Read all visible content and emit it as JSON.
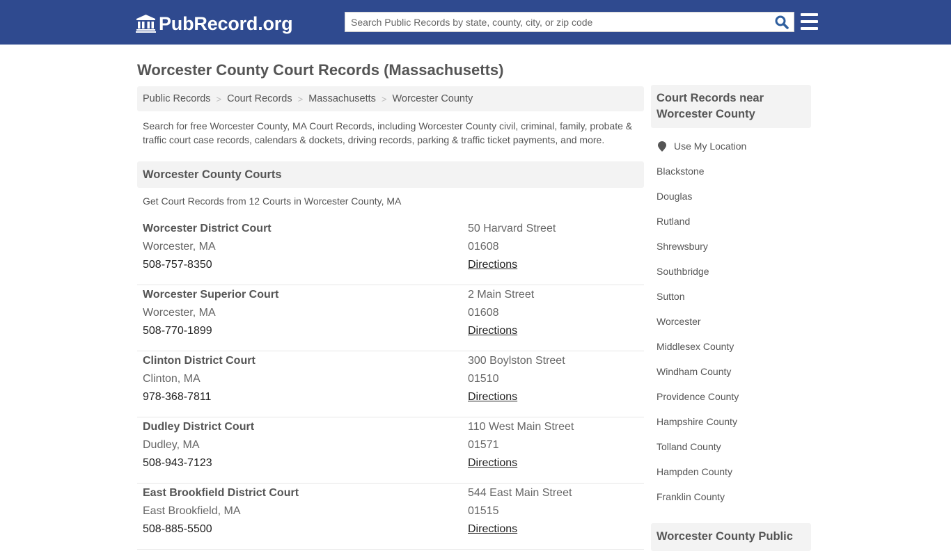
{
  "header": {
    "site_name": "PubRecord.org",
    "search_placeholder": "Search Public Records by state, county, city, or zip code",
    "search_value": "",
    "brand_color": "#2f4a8f",
    "icons": {
      "logo": "courthouse-icon",
      "search": "search-icon",
      "menu": "hamburger-menu-icon"
    }
  },
  "main": {
    "title": "Worcester County Court Records (Massachusetts)",
    "breadcrumb": [
      "Public Records",
      "Court Records",
      "Massachusetts",
      "Worcester County"
    ],
    "breadcrumb_separator": ">",
    "intro": "Search for free Worcester County, MA Court Records, including Worcester County civil, criminal, family, probate & traffic court case records, calendars & dockets, driving records, parking & traffic ticket payments, and more.",
    "section_title": "Worcester County Courts",
    "section_subtitle": "Get Court Records from 12 Courts in Worcester County, MA",
    "courts": [
      {
        "name": "Worcester District Court",
        "city": "Worcester, MA",
        "phone": "508-757-8350",
        "address": "50 Harvard Street",
        "zip": "01608",
        "directions": "Directions"
      },
      {
        "name": "Worcester Superior Court",
        "city": "Worcester, MA",
        "phone": "508-770-1899",
        "address": "2 Main Street",
        "zip": "01608",
        "directions": "Directions"
      },
      {
        "name": "Clinton District Court",
        "city": "Clinton, MA",
        "phone": "978-368-7811",
        "address": "300 Boylston Street",
        "zip": "01510",
        "directions": "Directions"
      },
      {
        "name": "Dudley District Court",
        "city": "Dudley, MA",
        "phone": "508-943-7123",
        "address": "110 West Main Street",
        "zip": "01571",
        "directions": "Directions"
      },
      {
        "name": "East Brookfield District Court",
        "city": "East Brookfield, MA",
        "phone": "508-885-5500",
        "address": "544 East Main Street",
        "zip": "01515",
        "directions": "Directions"
      }
    ]
  },
  "sidebar": {
    "title": "Court Records near Worcester County",
    "use_location": "Use My Location",
    "location_icon": "map-marker-icon",
    "items": [
      "Blackstone",
      "Douglas",
      "Rutland",
      "Shrewsbury",
      "Southbridge",
      "Sutton",
      "Worcester",
      "Middlesex County",
      "Windham County",
      "Providence County",
      "Hampshire County",
      "Tolland County",
      "Hampden County",
      "Franklin County"
    ],
    "next_section_title": "Worcester County Public"
  }
}
